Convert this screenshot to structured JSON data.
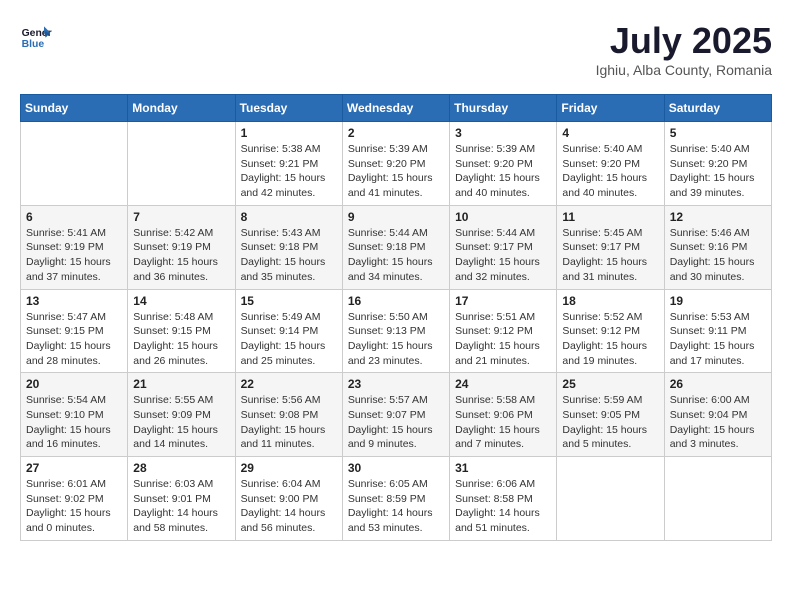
{
  "header": {
    "logo_line1": "General",
    "logo_line2": "Blue",
    "month_title": "July 2025",
    "location": "Ighiu, Alba County, Romania"
  },
  "weekdays": [
    "Sunday",
    "Monday",
    "Tuesday",
    "Wednesday",
    "Thursday",
    "Friday",
    "Saturday"
  ],
  "weeks": [
    [
      {
        "day": "",
        "info": ""
      },
      {
        "day": "",
        "info": ""
      },
      {
        "day": "1",
        "info": "Sunrise: 5:38 AM\nSunset: 9:21 PM\nDaylight: 15 hours\nand 42 minutes."
      },
      {
        "day": "2",
        "info": "Sunrise: 5:39 AM\nSunset: 9:20 PM\nDaylight: 15 hours\nand 41 minutes."
      },
      {
        "day": "3",
        "info": "Sunrise: 5:39 AM\nSunset: 9:20 PM\nDaylight: 15 hours\nand 40 minutes."
      },
      {
        "day": "4",
        "info": "Sunrise: 5:40 AM\nSunset: 9:20 PM\nDaylight: 15 hours\nand 40 minutes."
      },
      {
        "day": "5",
        "info": "Sunrise: 5:40 AM\nSunset: 9:20 PM\nDaylight: 15 hours\nand 39 minutes."
      }
    ],
    [
      {
        "day": "6",
        "info": "Sunrise: 5:41 AM\nSunset: 9:19 PM\nDaylight: 15 hours\nand 37 minutes."
      },
      {
        "day": "7",
        "info": "Sunrise: 5:42 AM\nSunset: 9:19 PM\nDaylight: 15 hours\nand 36 minutes."
      },
      {
        "day": "8",
        "info": "Sunrise: 5:43 AM\nSunset: 9:18 PM\nDaylight: 15 hours\nand 35 minutes."
      },
      {
        "day": "9",
        "info": "Sunrise: 5:44 AM\nSunset: 9:18 PM\nDaylight: 15 hours\nand 34 minutes."
      },
      {
        "day": "10",
        "info": "Sunrise: 5:44 AM\nSunset: 9:17 PM\nDaylight: 15 hours\nand 32 minutes."
      },
      {
        "day": "11",
        "info": "Sunrise: 5:45 AM\nSunset: 9:17 PM\nDaylight: 15 hours\nand 31 minutes."
      },
      {
        "day": "12",
        "info": "Sunrise: 5:46 AM\nSunset: 9:16 PM\nDaylight: 15 hours\nand 30 minutes."
      }
    ],
    [
      {
        "day": "13",
        "info": "Sunrise: 5:47 AM\nSunset: 9:15 PM\nDaylight: 15 hours\nand 28 minutes."
      },
      {
        "day": "14",
        "info": "Sunrise: 5:48 AM\nSunset: 9:15 PM\nDaylight: 15 hours\nand 26 minutes."
      },
      {
        "day": "15",
        "info": "Sunrise: 5:49 AM\nSunset: 9:14 PM\nDaylight: 15 hours\nand 25 minutes."
      },
      {
        "day": "16",
        "info": "Sunrise: 5:50 AM\nSunset: 9:13 PM\nDaylight: 15 hours\nand 23 minutes."
      },
      {
        "day": "17",
        "info": "Sunrise: 5:51 AM\nSunset: 9:12 PM\nDaylight: 15 hours\nand 21 minutes."
      },
      {
        "day": "18",
        "info": "Sunrise: 5:52 AM\nSunset: 9:12 PM\nDaylight: 15 hours\nand 19 minutes."
      },
      {
        "day": "19",
        "info": "Sunrise: 5:53 AM\nSunset: 9:11 PM\nDaylight: 15 hours\nand 17 minutes."
      }
    ],
    [
      {
        "day": "20",
        "info": "Sunrise: 5:54 AM\nSunset: 9:10 PM\nDaylight: 15 hours\nand 16 minutes."
      },
      {
        "day": "21",
        "info": "Sunrise: 5:55 AM\nSunset: 9:09 PM\nDaylight: 15 hours\nand 14 minutes."
      },
      {
        "day": "22",
        "info": "Sunrise: 5:56 AM\nSunset: 9:08 PM\nDaylight: 15 hours\nand 11 minutes."
      },
      {
        "day": "23",
        "info": "Sunrise: 5:57 AM\nSunset: 9:07 PM\nDaylight: 15 hours\nand 9 minutes."
      },
      {
        "day": "24",
        "info": "Sunrise: 5:58 AM\nSunset: 9:06 PM\nDaylight: 15 hours\nand 7 minutes."
      },
      {
        "day": "25",
        "info": "Sunrise: 5:59 AM\nSunset: 9:05 PM\nDaylight: 15 hours\nand 5 minutes."
      },
      {
        "day": "26",
        "info": "Sunrise: 6:00 AM\nSunset: 9:04 PM\nDaylight: 15 hours\nand 3 minutes."
      }
    ],
    [
      {
        "day": "27",
        "info": "Sunrise: 6:01 AM\nSunset: 9:02 PM\nDaylight: 15 hours\nand 0 minutes."
      },
      {
        "day": "28",
        "info": "Sunrise: 6:03 AM\nSunset: 9:01 PM\nDaylight: 14 hours\nand 58 minutes."
      },
      {
        "day": "29",
        "info": "Sunrise: 6:04 AM\nSunset: 9:00 PM\nDaylight: 14 hours\nand 56 minutes."
      },
      {
        "day": "30",
        "info": "Sunrise: 6:05 AM\nSunset: 8:59 PM\nDaylight: 14 hours\nand 53 minutes."
      },
      {
        "day": "31",
        "info": "Sunrise: 6:06 AM\nSunset: 8:58 PM\nDaylight: 14 hours\nand 51 minutes."
      },
      {
        "day": "",
        "info": ""
      },
      {
        "day": "",
        "info": ""
      }
    ]
  ]
}
